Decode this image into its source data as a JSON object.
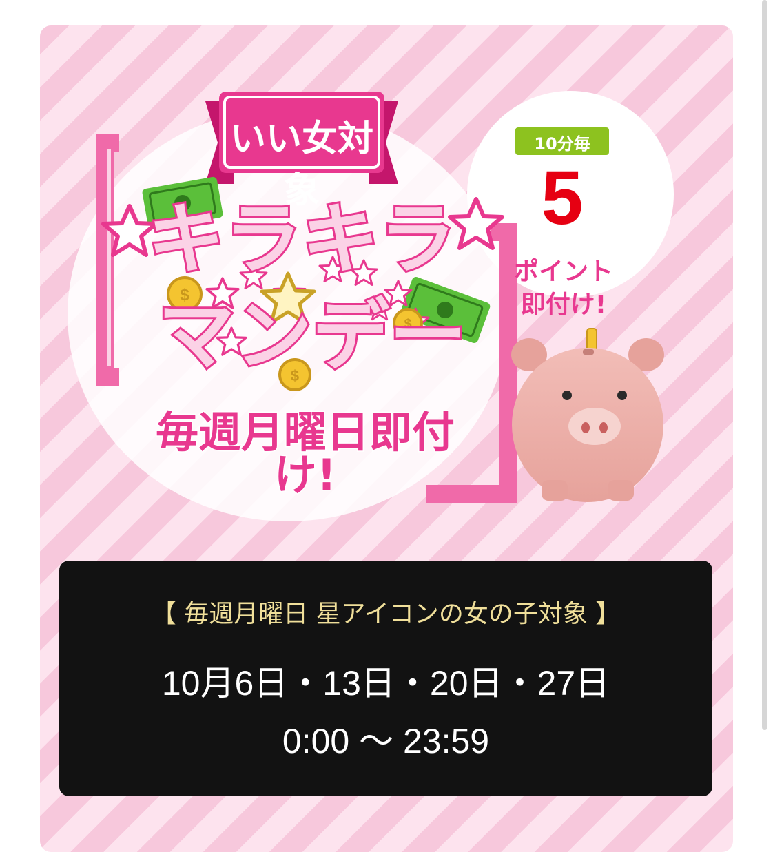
{
  "banner": {
    "target_label": "いい女対象",
    "title_line1": "キラキラ",
    "title_line2": "マンデー",
    "subtitle": "毎週月曜日即付け!",
    "badge_interval": "10分毎",
    "badge_points": "5",
    "badge_line1": "ポイント",
    "badge_line2": "即付け!"
  },
  "info": {
    "heading": "【 毎週月曜日 星アイコンの女の子対象 】",
    "dates": "10月6日・13日・20日・27日",
    "time": "0:00 〜 23:59"
  },
  "colors": {
    "stripe_light": "#fde3ee",
    "stripe_dark": "#f7c8dc",
    "brand_pink": "#e8388f",
    "badge_green": "#8dc21f",
    "points_red": "#e60012",
    "heading_gold": "#f0df9a",
    "panel_black": "#121212"
  },
  "icons": [
    "star-icon",
    "coin-icon",
    "banknote-icon",
    "piggy-bank-icon"
  ]
}
